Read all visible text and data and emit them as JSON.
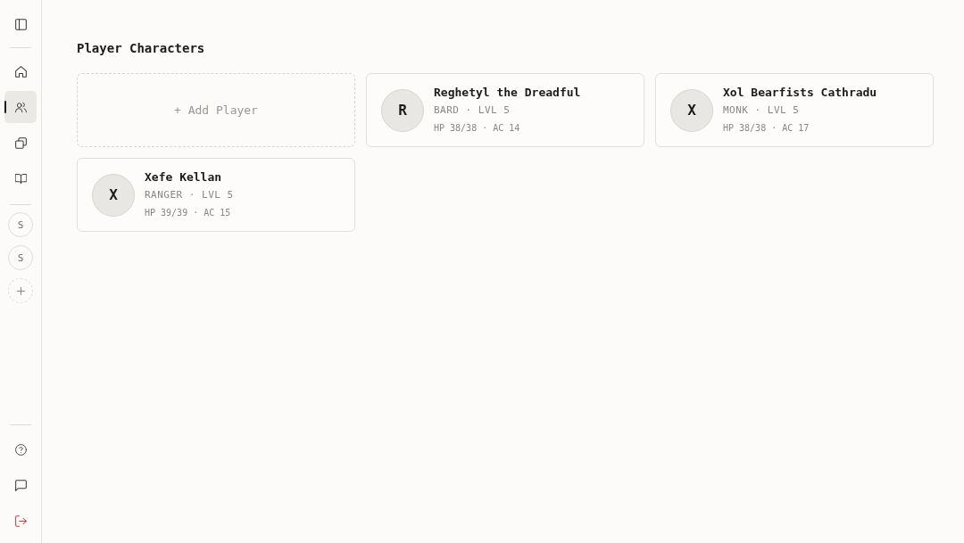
{
  "sidebar": {
    "nav": [
      {
        "kind": "home",
        "selected": false
      },
      {
        "kind": "players",
        "selected": true
      },
      {
        "kind": "cards",
        "selected": false
      },
      {
        "kind": "book",
        "selected": false
      }
    ],
    "campaigns": [
      {
        "initial": "S"
      },
      {
        "initial": "S"
      }
    ]
  },
  "main": {
    "title": "Player Characters",
    "add_button": "+ Add Player",
    "players": [
      {
        "initial": "R",
        "name": "Reghetyl the Dreadful",
        "summary": "BARD · LVL 5",
        "stats": "HP 38/38 · AC 14"
      },
      {
        "initial": "X",
        "name": "Xol Bearfists Cathradu",
        "summary": "MONK · LVL 5",
        "stats": "HP 38/38 · AC 17"
      },
      {
        "initial": "X",
        "name": "Xefe Kellan",
        "summary": "RANGER · LVL 5",
        "stats": "HP 39/39 · AC 15"
      }
    ]
  }
}
